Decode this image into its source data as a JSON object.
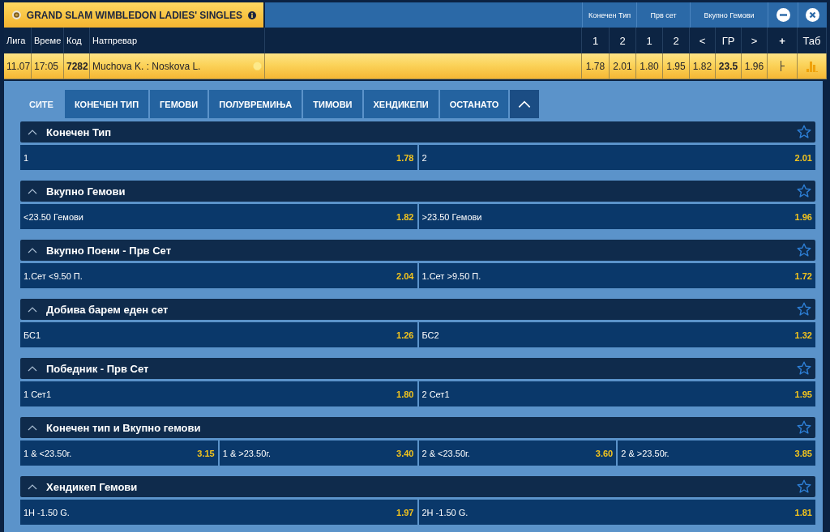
{
  "league": {
    "title": "GRAND SLAM WIMBLEDON LADIES' SINGLES"
  },
  "table": {
    "columns": [
      "Лига",
      "Време",
      "Код",
      "Натпревар"
    ],
    "odds_groups": [
      {
        "title": "Конечен Тип",
        "columns": [
          "1",
          "2"
        ]
      },
      {
        "title": "Прв сет",
        "columns": [
          "1",
          "2"
        ]
      },
      {
        "title": "Вкупно Гемови",
        "columns": [
          "<",
          "ГР",
          ">"
        ]
      }
    ],
    "extra_columns": [
      "+",
      "Таб"
    ],
    "rows": [
      {
        "date": "11.07",
        "time": "17:05",
        "code": "7282",
        "match": "Muchova K. : Noskova L.",
        "odds": [
          {
            "kind": "price",
            "value": "1.78"
          },
          {
            "kind": "price",
            "value": "2.01"
          },
          {
            "kind": "price",
            "value": "1.80"
          },
          {
            "kind": "price",
            "value": "1.95"
          },
          {
            "kind": "price",
            "value": "1.82"
          },
          {
            "kind": "line",
            "value": "23.5"
          },
          {
            "kind": "price",
            "value": "1.96"
          }
        ]
      }
    ]
  },
  "tabs": [
    {
      "label": "СИТЕ",
      "selected": true
    },
    {
      "label": "КОНЕЧЕН ТИП",
      "selected": false
    },
    {
      "label": "ГЕМОВИ",
      "selected": false
    },
    {
      "label": "ПОЛУВРЕМИЊА",
      "selected": false
    },
    {
      "label": "ТИМОВИ",
      "selected": false
    },
    {
      "label": "ХЕНДИКЕПИ",
      "selected": false
    },
    {
      "label": "ОСТАНАТО",
      "selected": false
    }
  ],
  "markets": [
    {
      "title": "Конечен Тип",
      "expanded": true,
      "outcomes": [
        {
          "label": "1",
          "odds": "1.78"
        },
        {
          "label": "2",
          "odds": "2.01"
        }
      ]
    },
    {
      "title": "Вкупно Гемови",
      "expanded": true,
      "outcomes": [
        {
          "label": "<23.50 Гемови",
          "odds": "1.82"
        },
        {
          "label": ">23.50 Гемови",
          "odds": "1.96"
        }
      ]
    },
    {
      "title": "Вкупно Поени - Прв Сет",
      "expanded": true,
      "outcomes": [
        {
          "label": "1.Сет <9.50 П.",
          "odds": "2.04"
        },
        {
          "label": "1.Сет >9.50 П.",
          "odds": "1.72"
        }
      ]
    },
    {
      "title": "Добива барем еден сет",
      "expanded": true,
      "outcomes": [
        {
          "label": "БС1",
          "odds": "1.26"
        },
        {
          "label": "БС2",
          "odds": "1.32"
        }
      ]
    },
    {
      "title": "Победник - Прв Сет",
      "expanded": true,
      "outcomes": [
        {
          "label": "1 Сет1",
          "odds": "1.80"
        },
        {
          "label": "2 Сет1",
          "odds": "1.95"
        }
      ]
    },
    {
      "title": "Конечен тип и Вкупно гемови",
      "expanded": true,
      "outcomes": [
        {
          "label": "1 & <23.50г.",
          "odds": "3.15"
        },
        {
          "label": "1 & >23.50г.",
          "odds": "3.40"
        },
        {
          "label": "2 & <23.50г.",
          "odds": "3.60"
        },
        {
          "label": "2 & >23.50г.",
          "odds": "3.85"
        }
      ]
    },
    {
      "title": "Хендикеп Гемови",
      "expanded": true,
      "outcomes": [
        {
          "label": "1H -1.50 G.",
          "odds": "1.97"
        },
        {
          "label": "2H -1.50 G.",
          "odds": "1.81"
        }
      ]
    }
  ]
}
